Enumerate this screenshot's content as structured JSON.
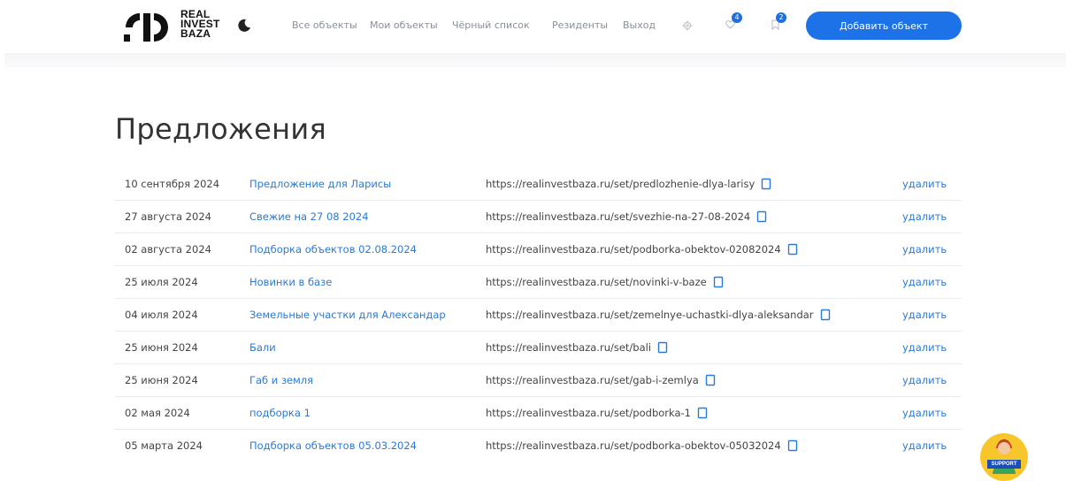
{
  "brand": {
    "logo_lines": [
      "REAL",
      "INVEST",
      "BAZA"
    ]
  },
  "nav": {
    "items": [
      "Все объекты",
      "Мои объекты",
      "Чёрный список",
      "Резиденты",
      "Выход"
    ],
    "favorites_count": "4",
    "bookmarks_count": "2",
    "add_button_label": "Добавить объект"
  },
  "page": {
    "title": "Предложения"
  },
  "offers": [
    {
      "date": "10 сентября 2024",
      "name": "Предложение для Ларисы",
      "url": "https://realinvestbaza.ru/set/predlozhenie-dlya-larisy",
      "action": "удалить"
    },
    {
      "date": "27 августа 2024",
      "name": "Свежие на 27 08 2024",
      "url": "https://realinvestbaza.ru/set/svezhie-na-27-08-2024",
      "action": "удалить"
    },
    {
      "date": "02 августа 2024",
      "name": "Подборка объектов 02.08.2024",
      "url": "https://realinvestbaza.ru/set/podborka-obektov-02082024",
      "action": "удалить"
    },
    {
      "date": "25 июля 2024",
      "name": "Новинки в базе",
      "url": "https://realinvestbaza.ru/set/novinki-v-baze",
      "action": "удалить"
    },
    {
      "date": "04 июля 2024",
      "name": "Земельные участки для Александар",
      "url": "https://realinvestbaza.ru/set/zemelnye-uchastki-dlya-aleksandar",
      "action": "удалить"
    },
    {
      "date": "25 июня 2024",
      "name": "Бали",
      "url": "https://realinvestbaza.ru/set/bali",
      "action": "удалить"
    },
    {
      "date": "25 июня 2024",
      "name": "Габ и земля",
      "url": "https://realinvestbaza.ru/set/gab-i-zemlya",
      "action": "удалить"
    },
    {
      "date": "02 мая 2024",
      "name": "подборка 1",
      "url": "https://realinvestbaza.ru/set/podborka-1",
      "action": "удалить"
    },
    {
      "date": "05 марта 2024",
      "name": "Подборка объектов 05.03.2024",
      "url": "https://realinvestbaza.ru/set/podborka-obektov-05032024",
      "action": "удалить"
    }
  ],
  "support": {
    "label": "SUPPORT"
  },
  "colors": {
    "accent": "#1d72e8",
    "link": "#2a7ad8",
    "text": "#333333",
    "nav_text": "#8a8f99",
    "support_bg": "#f7c62a"
  },
  "icons": [
    "moon-icon",
    "gear-icon",
    "heart-icon",
    "bookmark-icon",
    "copy-icon",
    "support-avatar-icon"
  ]
}
